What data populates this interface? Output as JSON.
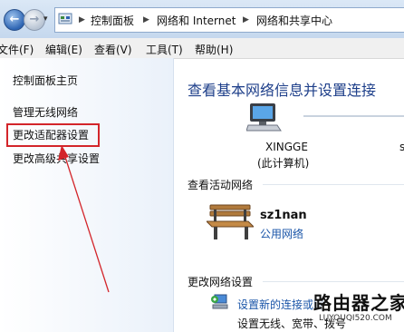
{
  "address_bar": {
    "crumbs": [
      "控制面板",
      "网络和 Internet",
      "网络和共享中心"
    ]
  },
  "menu": {
    "items": [
      "文件(F)",
      "编辑(E)",
      "查看(V)",
      "工具(T)",
      "帮助(H)"
    ]
  },
  "sidebar": {
    "items": [
      {
        "label": "控制面板主页"
      },
      {
        "label": "管理无线网络"
      },
      {
        "label": "更改适配器设置"
      },
      {
        "label": "更改高级共享设置"
      }
    ]
  },
  "main": {
    "title": "查看基本网络信息并设置连接",
    "computer": {
      "name": "XINGGE",
      "subtitle": "(此计算机)"
    },
    "next_node_partial": "s",
    "active_heading": "查看活动网络",
    "network": {
      "name": "sz1nan",
      "type": "公用网络"
    },
    "change_heading": "更改网络设置",
    "setup": {
      "link": "设置新的连接或网",
      "desc": "设置无线、宽带、拨号"
    }
  },
  "watermark": {
    "title": "路由器之家",
    "url": "LUYOUQI520.COM"
  },
  "colors": {
    "highlight": "#d3252a",
    "link": "#1a55a8",
    "title": "#1e3f8a"
  }
}
